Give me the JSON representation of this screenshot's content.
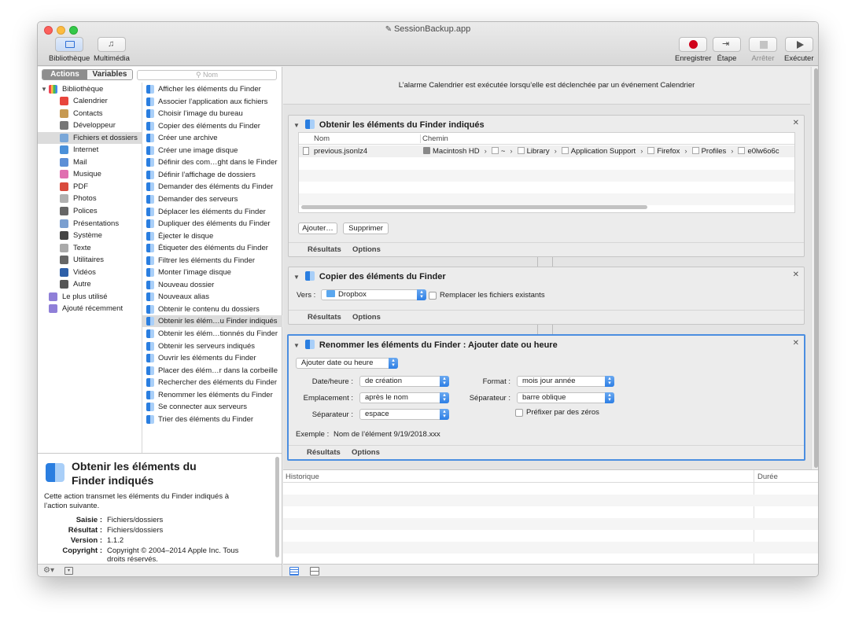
{
  "window": {
    "title": "SessionBackup.app"
  },
  "toolbar": {
    "library": "Bibliothèque",
    "media": "Multimédia",
    "record": "Enregistrer",
    "step": "Étape",
    "stop": "Arrêter",
    "run": "Exécuter"
  },
  "library": {
    "tabs": {
      "actions": "Actions",
      "variables": "Variables"
    },
    "search_placeholder": "Nom",
    "root": "Bibliothèque",
    "categories": [
      "Calendrier",
      "Contacts",
      "Développeur",
      "Fichiers et dossiers",
      "Internet",
      "Mail",
      "Musique",
      "PDF",
      "Photos",
      "Polices",
      "Présentations",
      "Système",
      "Texte",
      "Utilitaires",
      "Vidéos",
      "Autre"
    ],
    "selected_category": "Fichiers et dossiers",
    "extra": [
      "Le plus utilisé",
      "Ajouté récemment"
    ],
    "actions": [
      "Afficher les éléments du Finder",
      "Associer l’application aux fichiers",
      "Choisir l’image du bureau",
      "Copier des éléments du Finder",
      "Créer une archive",
      "Créer une image disque",
      "Définir des com…ght dans le Finder",
      "Définir l’affichage de dossiers",
      "Demander des éléments du Finder",
      "Demander des serveurs",
      "Déplacer les éléments du Finder",
      "Dupliquer des éléments du Finder",
      "Éjecter le disque",
      "Étiqueter des éléments du Finder",
      "Filtrer les éléments du Finder",
      "Monter l’image disque",
      "Nouveau dossier",
      "Nouveaux alias",
      "Obtenir le contenu du dossiers",
      "Obtenir les élém…u Finder indiqués",
      "Obtenir les élém…tionnés du Finder",
      "Obtenir les serveurs indiqués",
      "Ouvrir les éléments du Finder",
      "Placer des élém…r dans la corbeille",
      "Rechercher des éléments du Finder",
      "Renommer les éléments du Finder",
      "Se connecter aux serveurs",
      "Trier des éléments du Finder"
    ],
    "selected_action": "Obtenir les élém…u Finder indiqués"
  },
  "description": {
    "title": "Obtenir les éléments du Finder indiqués",
    "text": "Cette action transmet les éléments du Finder indiqués à l’action suivante.",
    "input_label": "Saisie :",
    "input_value": "Fichiers/dossiers",
    "result_label": "Résultat :",
    "result_value": "Fichiers/dossiers",
    "version_label": "Version :",
    "version_value": "1.1.2",
    "copyright_label": "Copyright :",
    "copyright_value": "Copyright © 2004–2014 Apple Inc. Tous droits réservés."
  },
  "workflow": {
    "banner": "L’alarme Calendrier est exécutée lorsqu’elle est déclenchée par un événement Calendrier",
    "results_tab": "Résultats",
    "options_tab": "Options",
    "block1": {
      "title": "Obtenir les éléments du Finder indiqués",
      "col_name": "Nom",
      "col_path": "Chemin",
      "file_name": "previous.jsonlz4",
      "path": [
        "Macintosh HD",
        "~",
        "Library",
        "Application Support",
        "Firefox",
        "Profiles",
        "e0lw6o6c"
      ],
      "add_button": "Ajouter…",
      "remove_button": "Supprimer"
    },
    "block2": {
      "title": "Copier des éléments du Finder",
      "to_label": "Vers :",
      "to_value": "Dropbox",
      "replace_label": "Remplacer les fichiers existants",
      "replace_checked": false
    },
    "block3": {
      "title": "Renommer les éléments du Finder : Ajouter date ou heure",
      "mode": "Ajouter date ou heure",
      "date_label": "Date/heure :",
      "date_value": "de création",
      "location_label": "Emplacement :",
      "location_value": "après le nom",
      "separator_label": "Séparateur :",
      "separator_value": "espace",
      "format_label": "Format :",
      "format_value": "mois jour année",
      "separator2_label": "Séparateur :",
      "separator2_value": "barre oblique",
      "zeros_label": "Préfixer par des zéros",
      "zeros_checked": false,
      "example_label": "Exemple :",
      "example_value": "Nom de l’élément 9/19/2018.xxx"
    }
  },
  "log": {
    "col_history": "Historique",
    "col_duration": "Durée"
  },
  "colors": {
    "accent": "#2d7ee5",
    "record": "#d0021b",
    "selection": "#dcdcdc"
  }
}
